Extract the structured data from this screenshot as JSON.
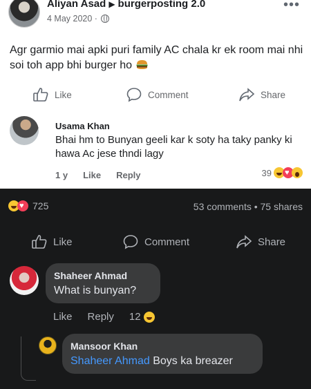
{
  "post": {
    "author": "Aliyan Asad",
    "group": "burgerposting 2.0",
    "date": "4 May 2020",
    "text": "Agr garmio mai apki puri family AC chala kr ek room mai nhi soi toh app bhi burger ho",
    "more": "•••"
  },
  "light_actions": {
    "like": "Like",
    "comment": "Comment",
    "share": "Share"
  },
  "comment1": {
    "author": "Usama Khan",
    "text": "Bhai hm to Bunyan geeli kar k soty ha taky panky ki hawa Ac jese thndi lagy",
    "time": "1 y",
    "like": "Like",
    "reply": "Reply",
    "reaction_count": "39"
  },
  "stats": {
    "reaction_count": "725",
    "summary": "53 comments • 75 shares"
  },
  "dark_actions": {
    "like": "Like",
    "comment": "Comment",
    "share": "Share"
  },
  "comment2": {
    "author": "Shaheer Ahmad",
    "text": "What is bunyan?",
    "like": "Like",
    "reply": "Reply",
    "reaction_count": "12"
  },
  "comment3": {
    "author": "Mansoor Khan",
    "mention": "Shaheer Ahmad",
    "text": "Boys ka breazer"
  },
  "colors": {
    "light_bg": "#ffffff",
    "dark_bg": "#18191a",
    "mention": "#4599ff",
    "bubble": "#3a3b3c"
  }
}
